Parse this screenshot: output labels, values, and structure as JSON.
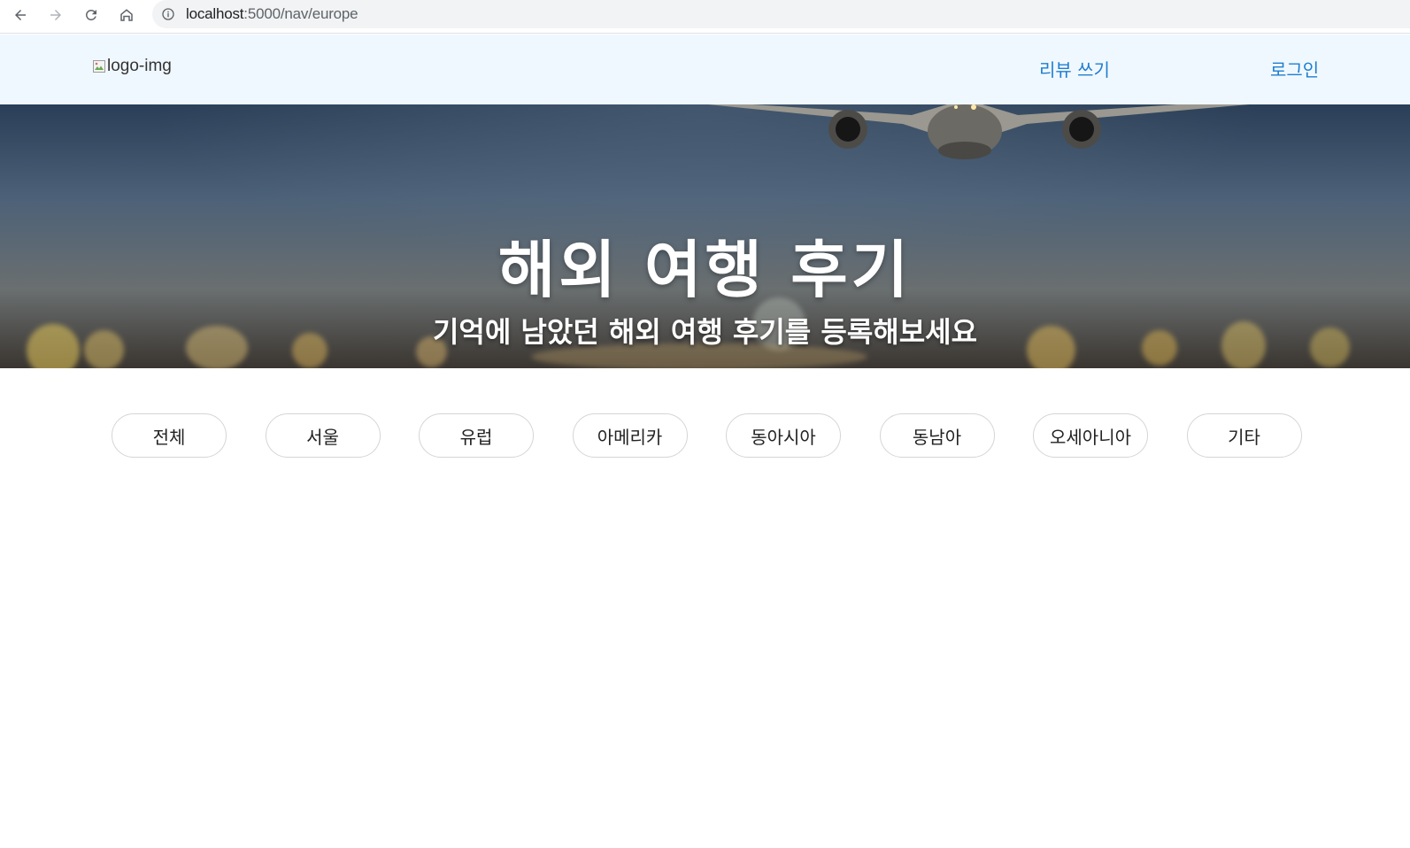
{
  "browser": {
    "url_host": "localhost",
    "url_path": ":5000/nav/europe"
  },
  "header": {
    "logo_alt": "logo-img",
    "links": [
      "리뷰 쓰기",
      "로그인"
    ],
    "background": "#f0f8ff",
    "link_color": "#1f7ed1"
  },
  "hero": {
    "title": "해외 여행 후기",
    "subtitle": "기억에 남았던 해외 여행 후기를 등록해보세요"
  },
  "categories": [
    "전체",
    "서울",
    "유럽",
    "아메리카",
    "동아시아",
    "동남아",
    "오세아니아",
    "기타"
  ]
}
